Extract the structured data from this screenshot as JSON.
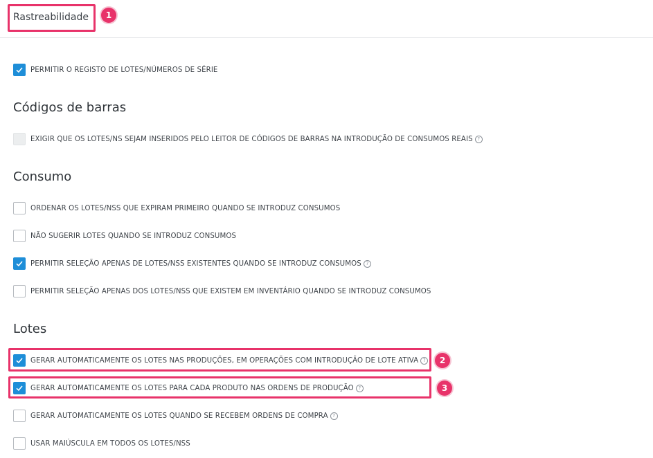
{
  "header": {
    "tab_title": "Rastreabilidade"
  },
  "callouts": [
    "1",
    "2",
    "3"
  ],
  "general": {
    "allow_lots": {
      "label": "PERMITIR O REGISTO DE LOTES/NÚMEROS DE SÉRIE",
      "checked": true
    }
  },
  "barcodes": {
    "title": "Códigos de barras",
    "require_scanner": {
      "label": "EXIGIR QUE OS LOTES/NS SEJAM INSERIDOS PELO LEITOR DE CÓDIGOS DE BARRAS NA INTRODUÇÃO DE CONSUMOS REAIS",
      "checked": false,
      "disabled": true
    }
  },
  "consumption": {
    "title": "Consumo",
    "items": [
      {
        "label": "ORDENAR OS LOTES/NSS QUE EXPIRAM PRIMEIRO QUANDO SE INTRODUZ CONSUMOS",
        "checked": false
      },
      {
        "label": "NÃO SUGERIR LOTES QUANDO SE INTRODUZ CONSUMOS",
        "checked": false
      },
      {
        "label": "PERMITIR SELEÇÃO APENAS DE LOTES/NSS EXISTENTES QUANDO SE INTRODUZ CONSUMOS",
        "checked": true
      },
      {
        "label": "PERMITIR SELEÇÃO APENAS DOS LOTES/NSS QUE EXISTEM EM INVENTÁRIO QUANDO SE INTRODUZ CONSUMOS",
        "checked": false
      }
    ]
  },
  "lots": {
    "title": "Lotes",
    "items": [
      {
        "label": "GERAR AUTOMATICAMENTE OS LOTES NAS PRODUÇÕES, EM OPERAÇÕES COM INTRODUÇÃO DE LOTE ATIVA",
        "checked": true
      },
      {
        "label": "GERAR AUTOMATICAMENTE OS LOTES PARA CADA PRODUTO NAS ORDENS DE PRODUÇÃO",
        "checked": true
      },
      {
        "label": "GERAR AUTOMATICAMENTE OS LOTES QUANDO SE RECEBEM ORDENS DE COMPRA",
        "checked": false
      },
      {
        "label": "USAR MAIÚSCULA EM TODOS OS LOTES/NSS",
        "checked": false
      }
    ]
  },
  "help_glyph": "?",
  "colors": {
    "accent": "#1e8ed8",
    "highlight": "#e8336a"
  }
}
